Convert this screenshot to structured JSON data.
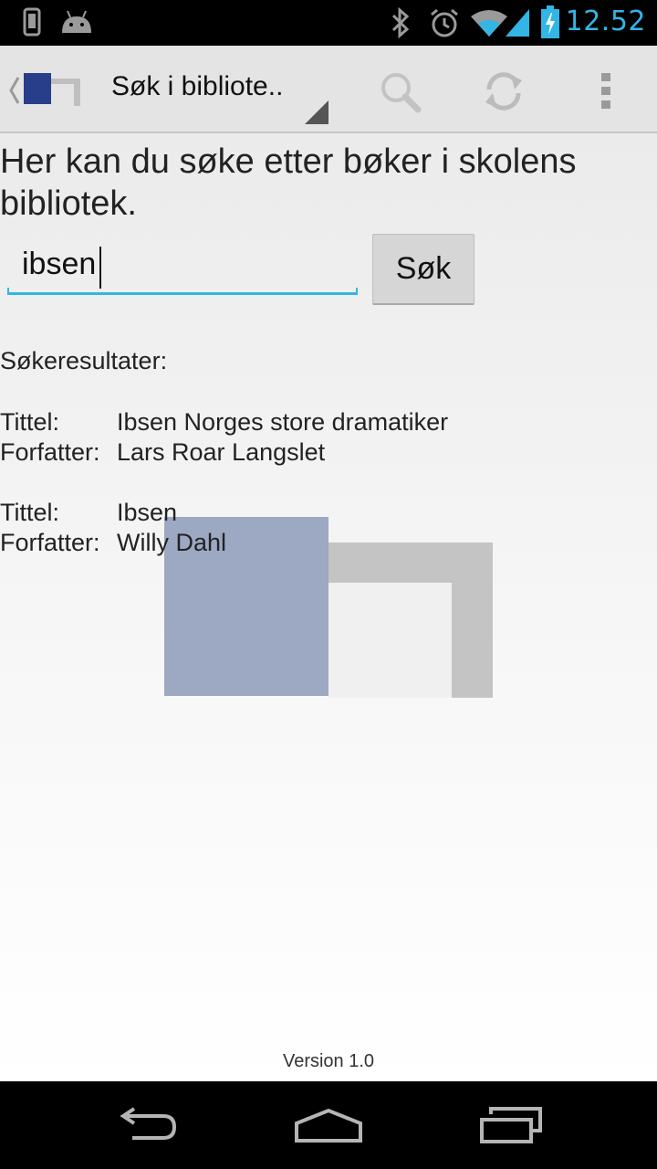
{
  "status_bar": {
    "time": "12.52",
    "icons": [
      "phone-icon",
      "android-icon",
      "bluetooth-icon",
      "alarm-icon",
      "wifi-icon",
      "signal-icon",
      "battery-charging-icon"
    ]
  },
  "action_bar": {
    "title": "Søk i bibliote..",
    "actions": [
      "search-icon",
      "refresh-icon",
      "overflow-menu-icon"
    ]
  },
  "main": {
    "intro": "Her kan du søke etter bøker i skolens bibliotek.",
    "search_value": "ibsen",
    "search_button": "Søk",
    "results_heading": "Søkeresultater:",
    "results": [
      {
        "title_label": "Tittel:",
        "title": "Ibsen Norges store dramatiker",
        "author_label": "Forfatter:",
        "author": "Lars Roar Langslet"
      },
      {
        "title_label": "Tittel:",
        "title": "Ibsen",
        "author_label": "Forfatter:",
        "author": "Willy Dahl"
      }
    ],
    "version": "Version 1.0"
  },
  "nav_bar": {
    "buttons": [
      "back-icon",
      "home-icon",
      "recent-apps-icon"
    ]
  },
  "colors": {
    "accent": "#33b5e5",
    "logo_blue": "#283e8a",
    "logo_gray": "#bfbfbf"
  }
}
